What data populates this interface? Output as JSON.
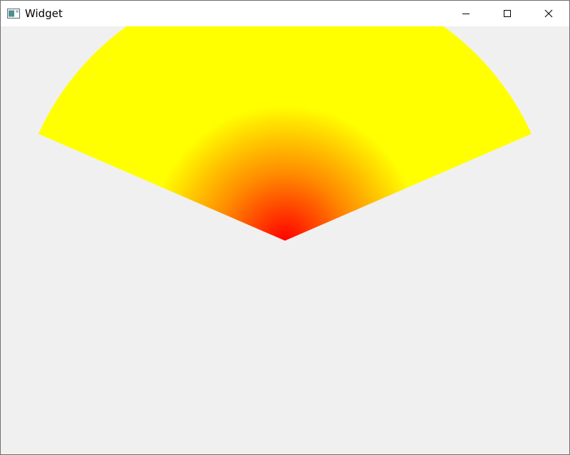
{
  "window": {
    "title": "Widget",
    "icon": "app-window-icon",
    "controls": [
      "minimize-icon",
      "maximize-icon",
      "close-icon"
    ]
  },
  "canvas": {
    "shape": "pie-sector",
    "gradient": "radial",
    "colors": {
      "center": "#ff0000",
      "middle": "#ff8c00",
      "outer": "#ffff00",
      "background": "#f0f0f0"
    }
  }
}
